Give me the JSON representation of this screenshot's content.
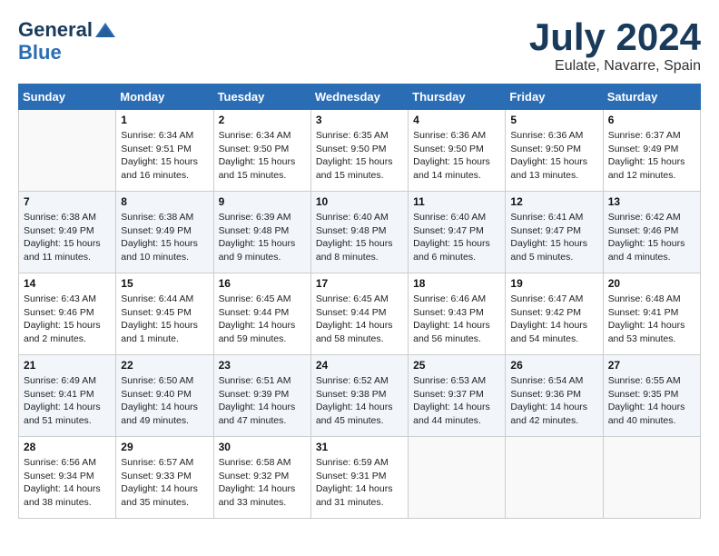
{
  "header": {
    "logo_line1": "General",
    "logo_line2": "Blue",
    "month_year": "July 2024",
    "location": "Eulate, Navarre, Spain"
  },
  "weekdays": [
    "Sunday",
    "Monday",
    "Tuesday",
    "Wednesday",
    "Thursday",
    "Friday",
    "Saturday"
  ],
  "weeks": [
    [
      {
        "day": "",
        "info": ""
      },
      {
        "day": "1",
        "info": "Sunrise: 6:34 AM\nSunset: 9:51 PM\nDaylight: 15 hours\nand 16 minutes."
      },
      {
        "day": "2",
        "info": "Sunrise: 6:34 AM\nSunset: 9:50 PM\nDaylight: 15 hours\nand 15 minutes."
      },
      {
        "day": "3",
        "info": "Sunrise: 6:35 AM\nSunset: 9:50 PM\nDaylight: 15 hours\nand 15 minutes."
      },
      {
        "day": "4",
        "info": "Sunrise: 6:36 AM\nSunset: 9:50 PM\nDaylight: 15 hours\nand 14 minutes."
      },
      {
        "day": "5",
        "info": "Sunrise: 6:36 AM\nSunset: 9:50 PM\nDaylight: 15 hours\nand 13 minutes."
      },
      {
        "day": "6",
        "info": "Sunrise: 6:37 AM\nSunset: 9:49 PM\nDaylight: 15 hours\nand 12 minutes."
      }
    ],
    [
      {
        "day": "7",
        "info": "Sunrise: 6:38 AM\nSunset: 9:49 PM\nDaylight: 15 hours\nand 11 minutes."
      },
      {
        "day": "8",
        "info": "Sunrise: 6:38 AM\nSunset: 9:49 PM\nDaylight: 15 hours\nand 10 minutes."
      },
      {
        "day": "9",
        "info": "Sunrise: 6:39 AM\nSunset: 9:48 PM\nDaylight: 15 hours\nand 9 minutes."
      },
      {
        "day": "10",
        "info": "Sunrise: 6:40 AM\nSunset: 9:48 PM\nDaylight: 15 hours\nand 8 minutes."
      },
      {
        "day": "11",
        "info": "Sunrise: 6:40 AM\nSunset: 9:47 PM\nDaylight: 15 hours\nand 6 minutes."
      },
      {
        "day": "12",
        "info": "Sunrise: 6:41 AM\nSunset: 9:47 PM\nDaylight: 15 hours\nand 5 minutes."
      },
      {
        "day": "13",
        "info": "Sunrise: 6:42 AM\nSunset: 9:46 PM\nDaylight: 15 hours\nand 4 minutes."
      }
    ],
    [
      {
        "day": "14",
        "info": "Sunrise: 6:43 AM\nSunset: 9:46 PM\nDaylight: 15 hours\nand 2 minutes."
      },
      {
        "day": "15",
        "info": "Sunrise: 6:44 AM\nSunset: 9:45 PM\nDaylight: 15 hours\nand 1 minute."
      },
      {
        "day": "16",
        "info": "Sunrise: 6:45 AM\nSunset: 9:44 PM\nDaylight: 14 hours\nand 59 minutes."
      },
      {
        "day": "17",
        "info": "Sunrise: 6:45 AM\nSunset: 9:44 PM\nDaylight: 14 hours\nand 58 minutes."
      },
      {
        "day": "18",
        "info": "Sunrise: 6:46 AM\nSunset: 9:43 PM\nDaylight: 14 hours\nand 56 minutes."
      },
      {
        "day": "19",
        "info": "Sunrise: 6:47 AM\nSunset: 9:42 PM\nDaylight: 14 hours\nand 54 minutes."
      },
      {
        "day": "20",
        "info": "Sunrise: 6:48 AM\nSunset: 9:41 PM\nDaylight: 14 hours\nand 53 minutes."
      }
    ],
    [
      {
        "day": "21",
        "info": "Sunrise: 6:49 AM\nSunset: 9:41 PM\nDaylight: 14 hours\nand 51 minutes."
      },
      {
        "day": "22",
        "info": "Sunrise: 6:50 AM\nSunset: 9:40 PM\nDaylight: 14 hours\nand 49 minutes."
      },
      {
        "day": "23",
        "info": "Sunrise: 6:51 AM\nSunset: 9:39 PM\nDaylight: 14 hours\nand 47 minutes."
      },
      {
        "day": "24",
        "info": "Sunrise: 6:52 AM\nSunset: 9:38 PM\nDaylight: 14 hours\nand 45 minutes."
      },
      {
        "day": "25",
        "info": "Sunrise: 6:53 AM\nSunset: 9:37 PM\nDaylight: 14 hours\nand 44 minutes."
      },
      {
        "day": "26",
        "info": "Sunrise: 6:54 AM\nSunset: 9:36 PM\nDaylight: 14 hours\nand 42 minutes."
      },
      {
        "day": "27",
        "info": "Sunrise: 6:55 AM\nSunset: 9:35 PM\nDaylight: 14 hours\nand 40 minutes."
      }
    ],
    [
      {
        "day": "28",
        "info": "Sunrise: 6:56 AM\nSunset: 9:34 PM\nDaylight: 14 hours\nand 38 minutes."
      },
      {
        "day": "29",
        "info": "Sunrise: 6:57 AM\nSunset: 9:33 PM\nDaylight: 14 hours\nand 35 minutes."
      },
      {
        "day": "30",
        "info": "Sunrise: 6:58 AM\nSunset: 9:32 PM\nDaylight: 14 hours\nand 33 minutes."
      },
      {
        "day": "31",
        "info": "Sunrise: 6:59 AM\nSunset: 9:31 PM\nDaylight: 14 hours\nand 31 minutes."
      },
      {
        "day": "",
        "info": ""
      },
      {
        "day": "",
        "info": ""
      },
      {
        "day": "",
        "info": ""
      }
    ]
  ]
}
